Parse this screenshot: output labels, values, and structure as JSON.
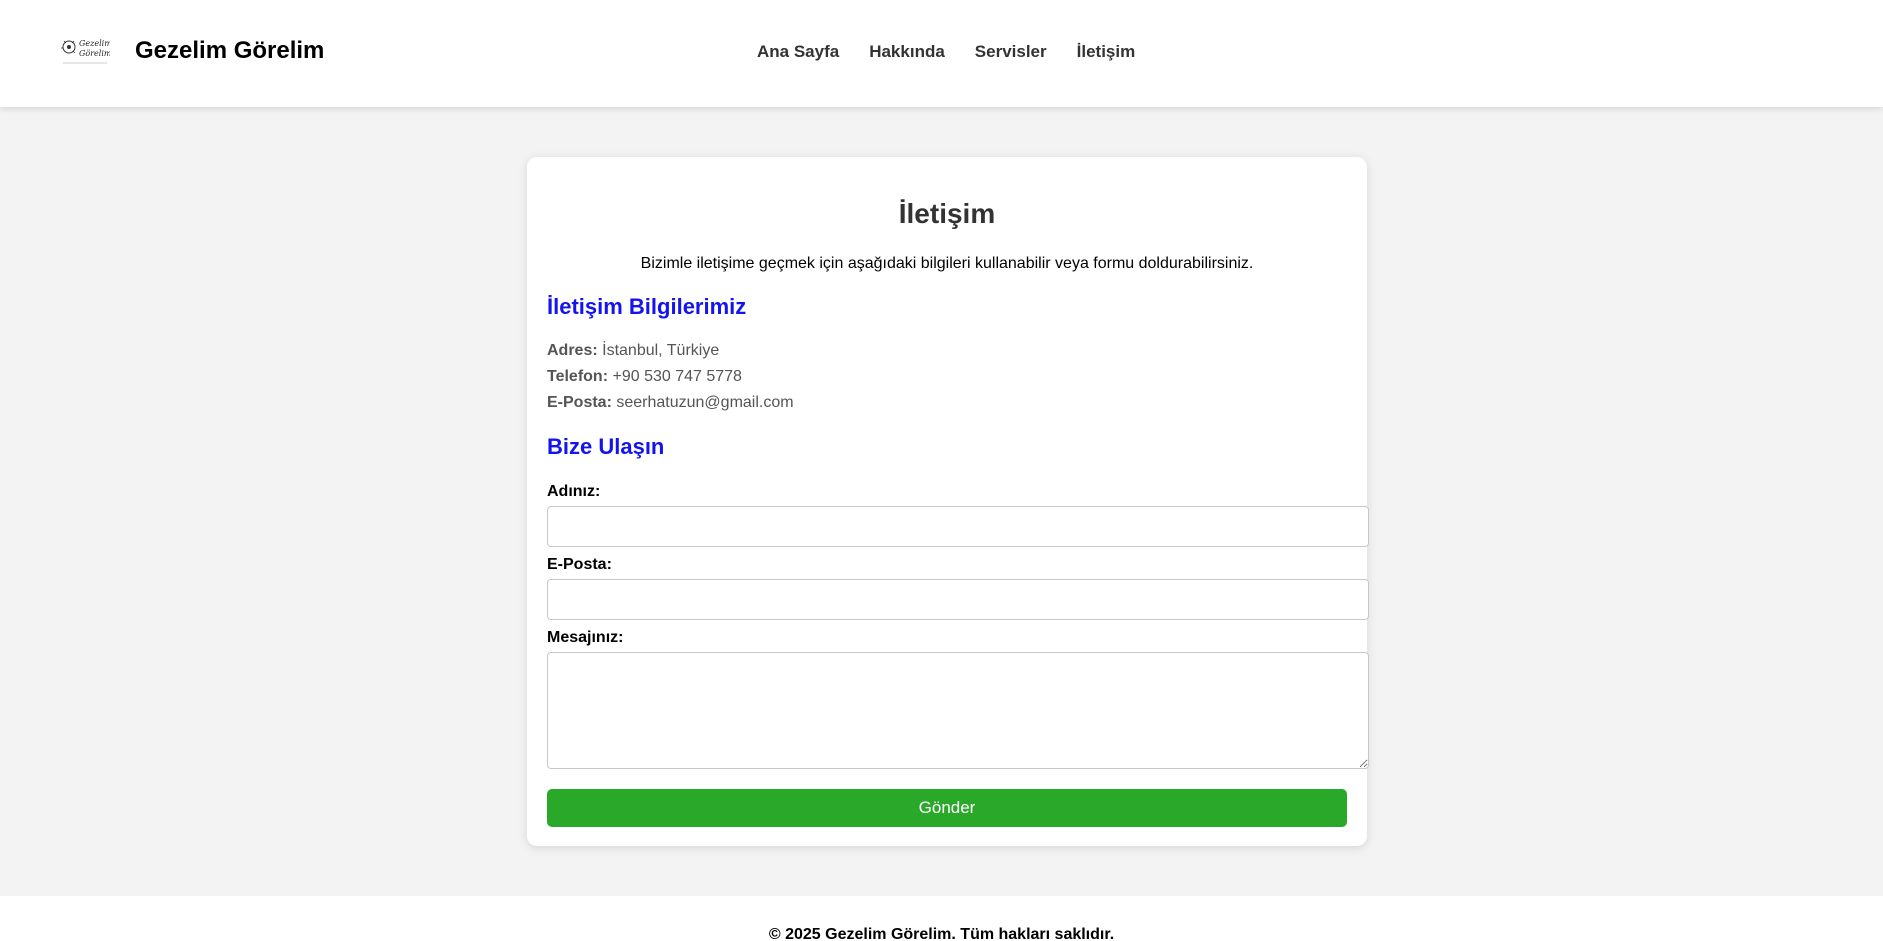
{
  "header": {
    "site_title": "Gezelim Görelim",
    "logo_text": "Gezelim Görelim",
    "nav": [
      "Ana Sayfa",
      "Hakkında",
      "Servisler",
      "İletişim"
    ]
  },
  "contact": {
    "title": "İletişim",
    "intro": "Bizimle iletişime geçmek için aşağıdaki bilgileri kullanabilir veya formu doldurabilirsiniz.",
    "info_title": "İletişim Bilgilerimiz",
    "address_label": "Adres:",
    "address_value": "İstanbul, Türkiye",
    "phone_label": "Telefon:",
    "phone_value": "+90 530 747 5778",
    "email_label": "E-Posta:",
    "email_value": "seerhatuzun@gmail.com",
    "form_title": "Bize Ulaşın",
    "form": {
      "name_label": "Adınız:",
      "name_value": "",
      "email_label": "E-Posta:",
      "email_value": "",
      "message_label": "Mesajınız:",
      "message_value": "",
      "submit_label": "Gönder"
    }
  },
  "footer": {
    "text": "© 2025 Gezelim Görelim. Tüm hakları saklıdır."
  },
  "colors": {
    "accent_heading": "#1414ee",
    "submit_button": "#2aa82a",
    "page_background": "#f3f3f3"
  }
}
